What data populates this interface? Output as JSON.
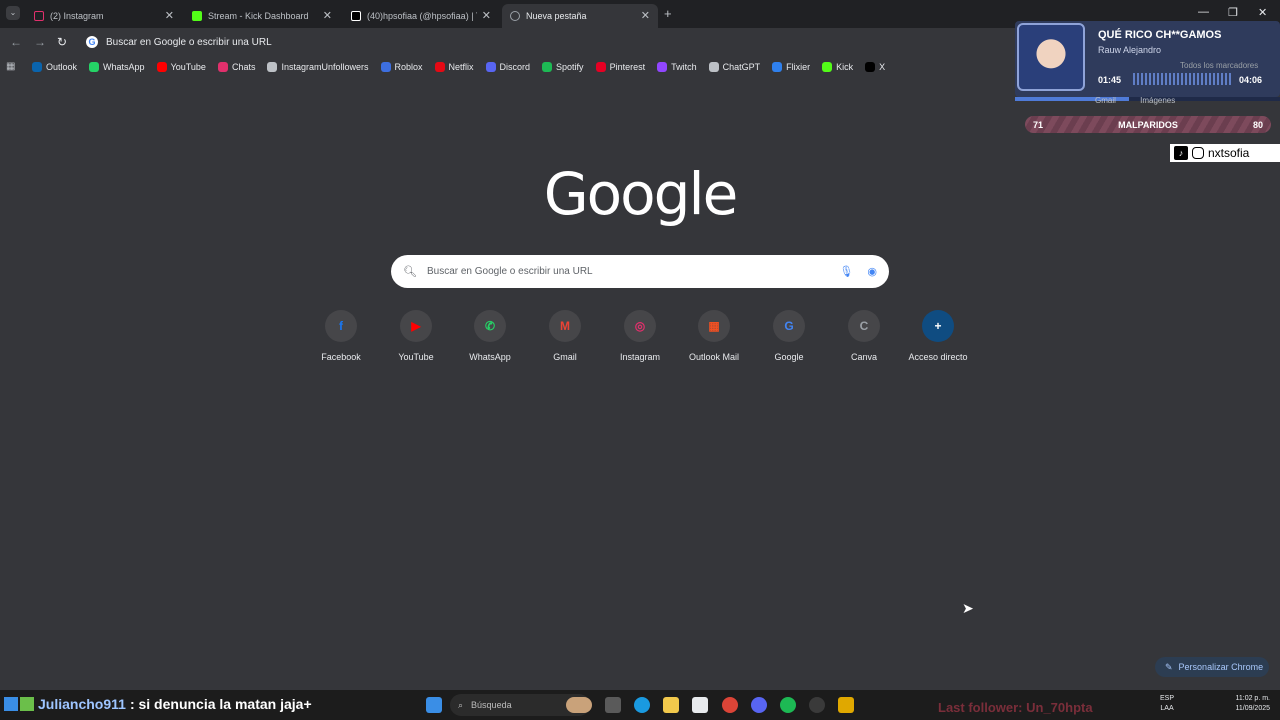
{
  "tabs": [
    {
      "title": "(2) Instagram",
      "icon": "instagram-icon",
      "color": "#e1306c",
      "active": false
    },
    {
      "title": "Stream - Kick Dashboard",
      "icon": "kick-icon",
      "color": "#53fc18",
      "active": false
    },
    {
      "title": "(40)hpsofiaa (@hpsofiaa) | TikT",
      "icon": "tiktok-icon",
      "color": "#ffffff",
      "active": false
    },
    {
      "title": "Nueva pestaña",
      "icon": "chrome-icon",
      "color": "#9aa0a6",
      "active": true
    }
  ],
  "omnibox": {
    "text": "Buscar en Google o escribir una URL"
  },
  "bookmarks": [
    {
      "label": "Outlook",
      "color": "#0a64ad"
    },
    {
      "label": "WhatsApp",
      "color": "#25d366"
    },
    {
      "label": "YouTube",
      "color": "#ff0000"
    },
    {
      "label": "Chats",
      "color": "#e1306c"
    },
    {
      "label": "InstagramUnfollowers",
      "color": "#bdc1c6"
    },
    {
      "label": "Roblox",
      "color": "#3d6fe0"
    },
    {
      "label": "Netflix",
      "color": "#e50914"
    },
    {
      "label": "Discord",
      "color": "#5865f2"
    },
    {
      "label": "Spotify",
      "color": "#1db954"
    },
    {
      "label": "Pinterest",
      "color": "#e60023"
    },
    {
      "label": "Twitch",
      "color": "#9146ff"
    },
    {
      "label": "ChatGPT",
      "color": "#bdc1c6"
    },
    {
      "label": "Flixier",
      "color": "#2f80ed"
    },
    {
      "label": "Kick",
      "color": "#53fc18"
    },
    {
      "label": "X",
      "color": "#000000"
    }
  ],
  "logo": "Google",
  "search": {
    "placeholder": "Buscar en Google o escribir una URL"
  },
  "shortcuts": [
    {
      "label": "Facebook",
      "glyph": "f",
      "color": "#1877f2"
    },
    {
      "label": "YouTube",
      "glyph": "▶",
      "color": "#ff0000"
    },
    {
      "label": "WhatsApp",
      "glyph": "✆",
      "color": "#25d366"
    },
    {
      "label": "Gmail",
      "glyph": "M",
      "color": "#ea4335"
    },
    {
      "label": "Instagram",
      "glyph": "◎",
      "color": "#e1306c"
    },
    {
      "label": "Outlook Mail",
      "glyph": "▦",
      "color": "#f25022"
    },
    {
      "label": "Google",
      "glyph": "G",
      "color": "#4285f4"
    },
    {
      "label": "Canva",
      "glyph": "C",
      "color": "#9aa0a6"
    },
    {
      "label": "Acceso directo",
      "glyph": "+",
      "color": "#ffffff"
    }
  ],
  "music": {
    "song": "QUÉ RICO CH**GAMOS",
    "artist": "Rauw Alejandro",
    "current": "01:45",
    "total": "04:06",
    "progress": 0.43,
    "bookmarks_label": "Todos los marcadores"
  },
  "behind": {
    "gmail": "Gmail",
    "images": "Imágenes"
  },
  "team": {
    "left": "71",
    "name": "MALPARIDOS",
    "right": "80"
  },
  "social": {
    "handle": "nxtsofia"
  },
  "customize": {
    "label": "Personalizar Chrome"
  },
  "chat": {
    "user": "Juliancho911",
    "message": ": si denuncia la matan jaja+"
  },
  "taskbar": {
    "search": "Búsqueda"
  },
  "follower": "Last follower: Un_70hpta",
  "tray": {
    "lang1": "ESP",
    "lang2": "LAA"
  },
  "clock": {
    "time": "11:02 p. m.",
    "date": "11/09/2025"
  }
}
